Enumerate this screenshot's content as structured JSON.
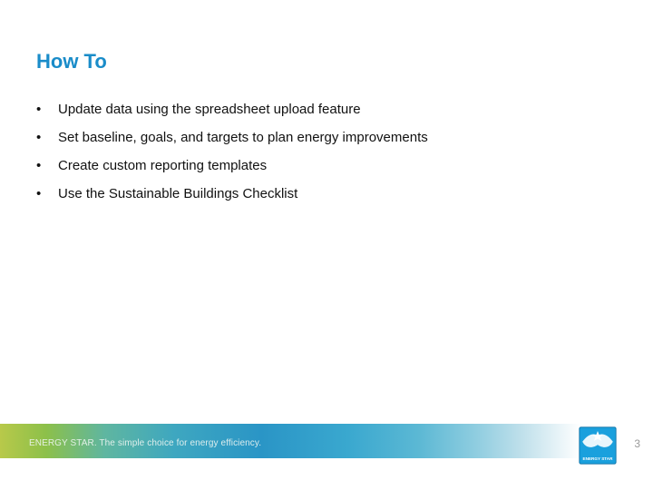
{
  "title": "How To",
  "bullets": [
    "Update data using the spreadsheet upload feature",
    "Set baseline, goals, and targets to plan energy improvements",
    "Create custom reporting templates",
    "Use the Sustainable Buildings Checklist"
  ],
  "footer_tagline": "ENERGY STAR. The simple choice for energy efficiency.",
  "page_number": "3",
  "logo_label": "ENERGY STAR"
}
